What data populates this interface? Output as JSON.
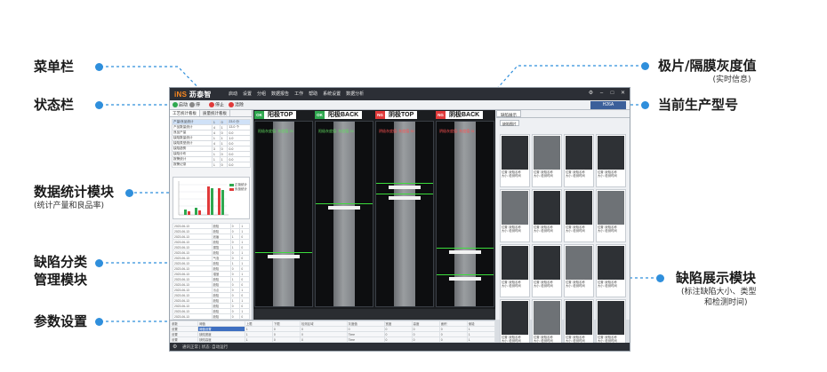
{
  "callouts": {
    "menubar": "菜单栏",
    "statusbar": "状态栏",
    "stats": "数据统计模块",
    "stats_sub": "(统计产量和良品率)",
    "defect_class_1": "缺陷分类",
    "defect_class_2": "管理模块",
    "params": "参数设置",
    "gray": "极片/隔膜灰度值",
    "gray_sub": "(实时信息)",
    "model": "当前生产型号",
    "defect_show": "缺陷展示模块",
    "defect_show_sub_1": "(标注缺陷大小、类型",
    "defect_show_sub_2": "和检测时间)"
  },
  "colors": {
    "accent": "#2f8fdc",
    "ok": "#2fa84f",
    "ng": "#e03a3a"
  },
  "app": {
    "logo_brand": "iNS",
    "logo_rest": " 沥泰智",
    "menu": [
      "启动",
      "设置",
      "分组",
      "数据报告",
      "工作",
      "帮助",
      "系统设置",
      "数据分析"
    ],
    "window_buttons": [
      "⚙",
      "–",
      "□",
      "✕"
    ],
    "status": {
      "start": "启动",
      "pause": "停",
      "stop": "停止",
      "reset": "清除"
    },
    "model": "H26A",
    "left_tabs": [
      "工艺统计看板",
      "质量统计看板"
    ],
    "stat_rows": [
      [
        "产量/良品统计",
        "1",
        "0",
        "23.0 分"
      ],
      [
        "产品数量统计",
        "4",
        "1",
        "13.0 个"
      ],
      [
        "良品产量",
        "4",
        "0",
        "0.0"
      ],
      [
        "缺陷数量统计",
        "1",
        "1",
        "1.0"
      ],
      [
        "缺陷类型统计",
        "4",
        "1",
        "0.0"
      ],
      [
        "缺陷趋势",
        "3",
        "0",
        "0.0"
      ],
      [
        "缺陷分布",
        "1",
        "0",
        "0.0"
      ],
      [
        "报警统计",
        "1",
        "1",
        "0.0"
      ],
      [
        "报警记录",
        "1",
        "0",
        "0.0"
      ]
    ],
    "chart_legend": [
      "正极统计",
      "负极统计"
    ],
    "defect_rows": [
      [
        "2023-06-13",
        "缺陷",
        "0",
        "1"
      ],
      [
        "2023-06-13",
        "缺陷",
        "0",
        "1"
      ],
      [
        "2023-06-13",
        "划痕",
        "1",
        "0"
      ],
      [
        "2023-06-13",
        "缺陷",
        "0",
        "1"
      ],
      [
        "2023-06-13",
        "漏箔",
        "1",
        "0"
      ],
      [
        "2023-06-13",
        "缺陷",
        "0",
        "1"
      ],
      [
        "2023-06-13",
        "气泡",
        "0",
        "0"
      ],
      [
        "2023-06-13",
        "缺陷",
        "1",
        "1"
      ],
      [
        "2023-06-13",
        "缺陷",
        "0",
        "0"
      ],
      [
        "2023-06-13",
        "褶皱",
        "0",
        "1"
      ],
      [
        "2023-06-13",
        "缺陷",
        "1",
        "0"
      ],
      [
        "2023-06-13",
        "缺陷",
        "0",
        "0"
      ],
      [
        "2023-06-13",
        "污点",
        "0",
        "1"
      ],
      [
        "2023-06-13",
        "缺陷",
        "0",
        "0"
      ],
      [
        "2023-06-13",
        "缺陷",
        "1",
        "1"
      ],
      [
        "2023-06-13",
        "缺陷",
        "0",
        "0"
      ],
      [
        "2023-06-13",
        "缺陷",
        "0",
        "1"
      ],
      [
        "2023-06-13",
        "缺陷",
        "0",
        "0"
      ]
    ],
    "panes": [
      {
        "badge": "OK",
        "badge_color": "#2fa84f",
        "title": "阳极TOP",
        "overlay": "阳极灰度值: 灰度值 25",
        "overlay_red": false
      },
      {
        "badge": "OK",
        "badge_color": "#2fa84f",
        "title": "阳极BACK",
        "overlay": "阳极灰度值: 灰度值 26",
        "overlay_red": false
      },
      {
        "badge": "NG",
        "badge_color": "#e03a3a",
        "title": "阴极TOP",
        "overlay": "阴极灰度值: 灰度值 30",
        "overlay_red": true
      },
      {
        "badge": "NG",
        "badge_color": "#e03a3a",
        "title": "阴极BACK",
        "overlay": "阴极灰度值: 灰度值 31",
        "overlay_red": true
      }
    ],
    "right_tab": "缺陷展示",
    "right_subtab": "缺陷图片",
    "thumb_caption_1": "位置: 缺陷名称",
    "thumb_caption_2": "大小: 检测时间",
    "params_header": [
      "参数",
      "阈值",
      "上限",
      "下限",
      "检测区域",
      "灰度值",
      "宽度",
      "高度",
      "面积",
      "使能"
    ],
    "params_rows": [
      [
        "设置",
        "阈值设置",
        "1",
        "0",
        "0",
        "0",
        "0",
        "0",
        "0",
        "1"
      ],
      [
        "设置",
        "缺陷宽度",
        "1",
        "0",
        "0",
        "Time",
        "0",
        "0",
        "0",
        "1"
      ],
      [
        "设置",
        "缺陷高度",
        "1",
        "0",
        "0",
        "Time",
        "0",
        "0",
        "0",
        "1"
      ],
      [
        "设置",
        "面积",
        "1",
        "0",
        "0",
        "Time",
        "0",
        "0",
        "0",
        "1"
      ],
      [
        "设置",
        "检测区域",
        "1",
        "0",
        "0",
        "Time",
        "0",
        "0",
        "0",
        "1"
      ]
    ],
    "footer": "通讯正常 | 状态: 自动运行"
  }
}
